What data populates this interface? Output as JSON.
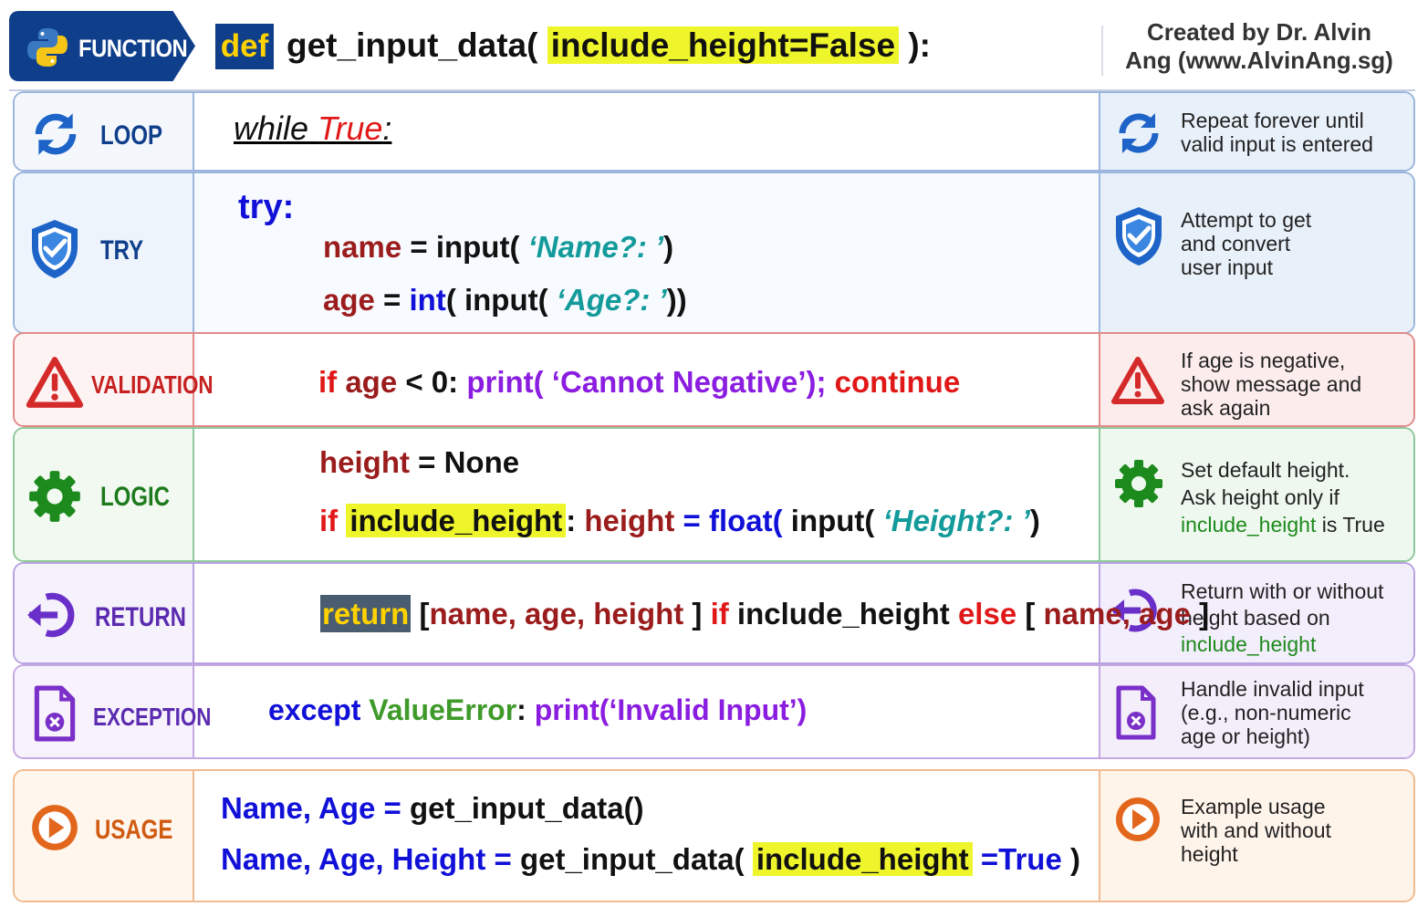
{
  "header": {
    "badge_label": "FUNCTION",
    "def_keyword": "def",
    "func_name": "get_input_data(",
    "param": "include_height=False",
    "close": "):",
    "credit_line1": "Created by Dr. Alvin",
    "credit_line2": "Ang (www.AlvinAng.sg)"
  },
  "rows": {
    "loop": {
      "label": "LOOP",
      "code_while": "while",
      "code_true": "True",
      "code_colon": ":",
      "note": [
        "Repeat forever until",
        "valid input is entered"
      ],
      "color": "#1565c0"
    },
    "try": {
      "label": "TRY",
      "kw": "try:",
      "l1_var": "name",
      "l1_eq": " = input( ",
      "l1_str": "‘Name?:  ’",
      "l1_end": ")",
      "l2_var": "age",
      "l2_eq": " = ",
      "l2_int": "int",
      "l2_mid": "( input( ",
      "l2_str": "‘Age?:  ’",
      "l2_end": "))",
      "note": [
        "Attempt to get",
        "and convert",
        "user input"
      ],
      "color": "#1565c0"
    },
    "validation": {
      "label": "VALIDATION",
      "c_if": "if ",
      "c_age": "age",
      "c_cond": " < 0: ",
      "c_print": "print( ‘Cannot Negative’); ",
      "c_continue": "continue",
      "note": [
        "If age is negative,",
        "show message and",
        "ask again"
      ],
      "color": "#d32f2f"
    },
    "logic": {
      "label": "LOGIC",
      "l1_var": "height",
      "l1_rest": " = None",
      "l2_if": "if ",
      "l2_param": "include_height",
      "l2_colon": ": ",
      "l2_var": "height",
      "l2_eq": " = ",
      "l2_float": "float(",
      "l2_mid": " input( ",
      "l2_str": "‘Height?:  ’",
      "l2_end": ")",
      "note_l1": "Set default height.",
      "note_l2": "Ask height only if",
      "note_l3_green": "include_height",
      "note_l3_rest": " is True",
      "color": "#2e7d32"
    },
    "return": {
      "label": "RETURN",
      "kw": "return",
      "p1_open": " [",
      "p1_list": "name, age, height",
      "p1_close": " ] ",
      "p_if": "if",
      "p_mid": " include_height ",
      "p_else": "else",
      "p2_open": " [ ",
      "p2_list": "name, age",
      "p2_close": " ]",
      "note_l1": "Return with or without",
      "note_l2": "height based on",
      "note_l3_green": "include_height",
      "color": "#6a3fc8"
    },
    "exception": {
      "label": "EXCEPTION",
      "kw": "except ",
      "err": "ValueError",
      "colon": ": ",
      "print": "print(‘Invalid Input’)",
      "note": [
        "Handle invalid input",
        "(e.g., non-numeric",
        "age or height)"
      ],
      "color": "#7b3fbf"
    },
    "usage": {
      "label": "USAGE",
      "l1_vars": "Name, Age",
      "l1_eq": " = ",
      "l1_call": "get_input_data()",
      "l2_vars": "Name, Age, Height",
      "l2_eq": " = ",
      "l2_call": "get_input_data( ",
      "l2_param": "include_height",
      "l2_eqt": " =True",
      "l2_end": " )",
      "note": [
        "Example usage",
        "with and without",
        "height"
      ],
      "color": "#e2671c"
    }
  },
  "icons": {
    "python": "python-logo",
    "loop": "refresh-icon",
    "try": "shield-check-icon",
    "validation": "warning-triangle-icon",
    "logic": "gear-icon",
    "return": "return-arrow-icon",
    "exception": "file-error-icon",
    "usage": "play-circle-icon"
  }
}
